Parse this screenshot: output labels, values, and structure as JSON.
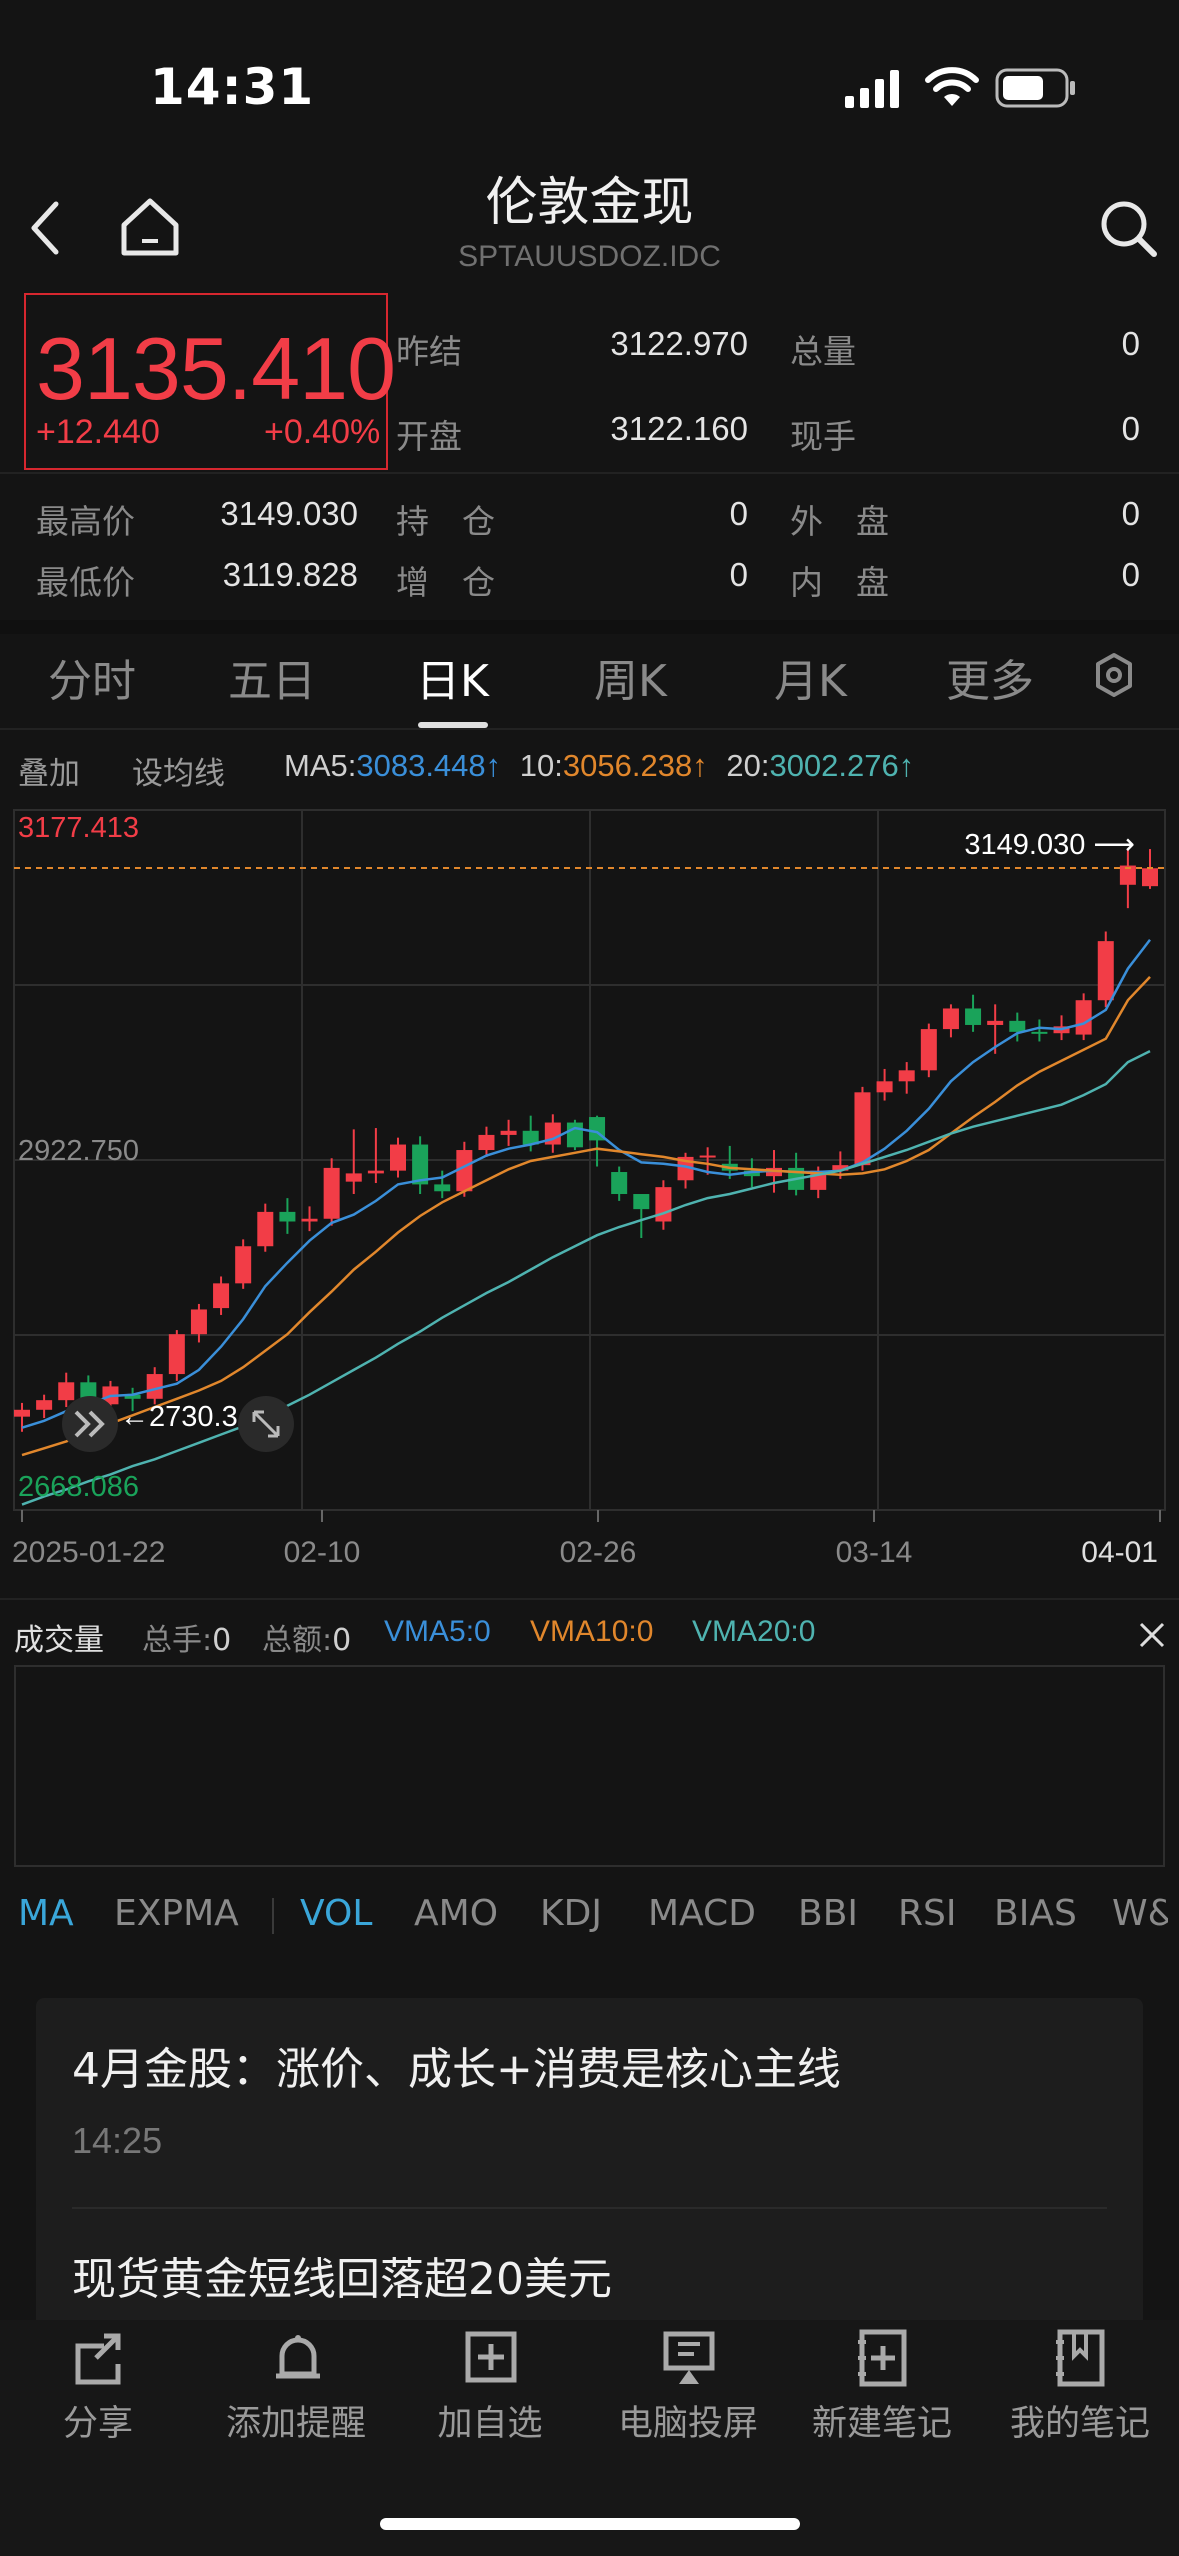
{
  "status_bar": {
    "time": "14:31"
  },
  "header": {
    "title": "伦敦金现",
    "code": "SPTAUUSDOZ.IDC"
  },
  "quote": {
    "price": "3135.410",
    "change": "+12.440",
    "change_pct": "+0.40%",
    "rows": [
      {
        "l1": "昨结",
        "v1": "3122.970",
        "l2": "总量",
        "v2": "0"
      },
      {
        "l1": "开盘",
        "v1": "3122.160",
        "l2": "现手",
        "v2": "0"
      }
    ],
    "rows2": [
      {
        "l0": "最高价",
        "v0": "3149.030",
        "l1": "持　仓",
        "v1": "0",
        "l2": "外　盘",
        "v2": "0"
      },
      {
        "l0": "最低价",
        "v0": "3119.828",
        "l1": "增　仓",
        "v1": "0",
        "l2": "内　盘",
        "v2": "0"
      }
    ]
  },
  "tabs": [
    "分时",
    "五日",
    "日K",
    "周K",
    "月K",
    "更多"
  ],
  "ma_bar": {
    "overlay": "叠加",
    "set_ma": "设均线",
    "ma5_label": "MA5:",
    "ma5": "3083.448↑",
    "ma10_label": "10:",
    "ma10": "3056.238↑",
    "ma20_label": "20:",
    "ma20": "3002.276↑"
  },
  "chart_labels": {
    "top": "3177.413",
    "mid": "2922.750",
    "bottom": "2668.086",
    "high_marker": "3149.030 ⟶",
    "low_marker": "←2730.3",
    "dates": [
      "2025-01-22",
      "02-10",
      "02-26",
      "03-14",
      "04-01"
    ]
  },
  "volume_bar": {
    "title": "成交量",
    "hands_label": "总手:",
    "hands": "0",
    "amount_label": "总额:",
    "amount": "0",
    "vma5": "VMA5:0",
    "vma10": "VMA10:0",
    "vma20": "VMA20:0"
  },
  "indicators": [
    "MA",
    "EXPMA",
    "VOL",
    "AMO",
    "KDJ",
    "MACD",
    "BBI",
    "RSI",
    "BIAS",
    "W&"
  ],
  "news": [
    {
      "title": "4月金股：涨价、成长+消费是核心主线",
      "time": "14:25"
    },
    {
      "title": "现货黄金短线回落超20美元"
    }
  ],
  "bottom_bar": [
    "分享",
    "添加提醒",
    "加自选",
    "电脑投屏",
    "新建笔记",
    "我的笔记"
  ],
  "colors": {
    "up": "#f23d47",
    "down": "#1aa35a",
    "ma5": "#3a8fd9",
    "ma10": "#e1872c",
    "ma20": "#4fb3b0"
  },
  "chart_data": {
    "type": "candlestick",
    "title": "",
    "ylim": [
      2668.086,
      3177.413
    ],
    "y_ticks": [
      3177.413,
      2922.75,
      2668.086
    ],
    "x_tick_labels": [
      "2025-01-22",
      "02-10",
      "02-26",
      "03-14",
      "04-01"
    ],
    "candles": [
      [
        2736,
        2741,
        2725,
        2746
      ],
      [
        2741,
        2748,
        2735,
        2752
      ],
      [
        2748,
        2761,
        2743,
        2768
      ],
      [
        2761,
        2745,
        2740,
        2766
      ],
      [
        2745,
        2758,
        2737,
        2762
      ],
      [
        2752,
        2749,
        2740,
        2757
      ],
      [
        2749,
        2767,
        2745,
        2772
      ],
      [
        2767,
        2796,
        2762,
        2799
      ],
      [
        2796,
        2814,
        2790,
        2818
      ],
      [
        2815,
        2833,
        2810,
        2838
      ],
      [
        2833,
        2860,
        2829,
        2865
      ],
      [
        2860,
        2885,
        2856,
        2891
      ],
      [
        2885,
        2878,
        2869,
        2895
      ],
      [
        2878,
        2880,
        2871,
        2889
      ],
      [
        2880,
        2917,
        2875,
        2924
      ],
      [
        2907,
        2913,
        2898,
        2945
      ],
      [
        2913,
        2915,
        2906,
        2946
      ],
      [
        2915,
        2934,
        2910,
        2939
      ],
      [
        2934,
        2905,
        2898,
        2940
      ],
      [
        2905,
        2900,
        2895,
        2915
      ],
      [
        2900,
        2930,
        2896,
        2936
      ],
      [
        2930,
        2941,
        2925,
        2947
      ],
      [
        2941,
        2944,
        2933,
        2952
      ],
      [
        2944,
        2934,
        2929,
        2955
      ],
      [
        2934,
        2950,
        2928,
        2956
      ],
      [
        2950,
        2932,
        2930,
        2952
      ],
      [
        2954,
        2937,
        2918,
        2955
      ],
      [
        2914,
        2898,
        2893,
        2918
      ],
      [
        2898,
        2887,
        2866,
        2893
      ],
      [
        2878,
        2903,
        2872,
        2908
      ],
      [
        2908,
        2925,
        2902,
        2928
      ],
      [
        2925,
        2926,
        2912,
        2932
      ],
      [
        2920,
        2915,
        2909,
        2933
      ],
      [
        2915,
        2911,
        2903,
        2924
      ],
      [
        2911,
        2917,
        2899,
        2930
      ],
      [
        2917,
        2901,
        2897,
        2928
      ],
      [
        2901,
        2915,
        2895,
        2918
      ],
      [
        2915,
        2919,
        2909,
        2929
      ],
      [
        2919,
        2972,
        2915,
        2976
      ],
      [
        2972,
        2980,
        2966,
        2989
      ],
      [
        2980,
        2988,
        2971,
        2994
      ],
      [
        2988,
        3018,
        2983,
        3022
      ],
      [
        3018,
        3033,
        3012,
        3036
      ],
      [
        3033,
        3021,
        3016,
        3043
      ],
      [
        3021,
        3024,
        3000,
        3036
      ],
      [
        3024,
        3016,
        3009,
        3030
      ],
      [
        3016,
        3015,
        3009,
        3025
      ],
      [
        3015,
        3020,
        3010,
        3028
      ],
      [
        3014,
        3039,
        3010,
        3044
      ],
      [
        3039,
        3082,
        3034,
        3089
      ],
      [
        3123,
        3137,
        3106,
        3149
      ],
      [
        3122,
        3135,
        3120,
        3149
      ]
    ],
    "series": [
      {
        "name": "MA5",
        "values": [
          2728,
          2733,
          2740,
          2745,
          2751,
          2752,
          2756,
          2760,
          2770,
          2787,
          2807,
          2831,
          2848,
          2864,
          2877,
          2883,
          2893,
          2905,
          2908,
          2910,
          2918,
          2926,
          2931,
          2934,
          2938,
          2946,
          2943,
          2930,
          2921,
          2920,
          2918,
          2914,
          2912,
          2914,
          2915,
          2914,
          2914,
          2915,
          2921,
          2931,
          2944,
          2960,
          2980,
          2994,
          3005,
          3015,
          3019,
          3018,
          3022,
          3032,
          3062,
          3083
        ]
      },
      {
        "name": "10",
        "values": [
          2708,
          2713,
          2718,
          2724,
          2731,
          2737,
          2743,
          2749,
          2755,
          2762,
          2772,
          2784,
          2796,
          2812,
          2827,
          2843,
          2856,
          2870,
          2882,
          2892,
          2900,
          2908,
          2916,
          2922,
          2925,
          2928,
          2931,
          2929,
          2927,
          2925,
          2922,
          2920,
          2917,
          2916,
          2915,
          2914,
          2913,
          2912,
          2913,
          2916,
          2922,
          2930,
          2942,
          2954,
          2965,
          2977,
          2987,
          2995,
          3003,
          3011,
          3039,
          3056
        ]
      },
      {
        "name": "20",
        "values": [
          2672,
          2678,
          2683,
          2689,
          2694,
          2700,
          2705,
          2711,
          2717,
          2723,
          2729,
          2736,
          2744,
          2752,
          2761,
          2770,
          2779,
          2789,
          2798,
          2808,
          2817,
          2826,
          2834,
          2843,
          2852,
          2860,
          2868,
          2874,
          2879,
          2884,
          2890,
          2895,
          2898,
          2902,
          2906,
          2909,
          2912,
          2915,
          2920,
          2925,
          2930,
          2936,
          2942,
          2947,
          2951,
          2955,
          2959,
          2963,
          2970,
          2978,
          2994,
          3002
        ]
      }
    ]
  }
}
